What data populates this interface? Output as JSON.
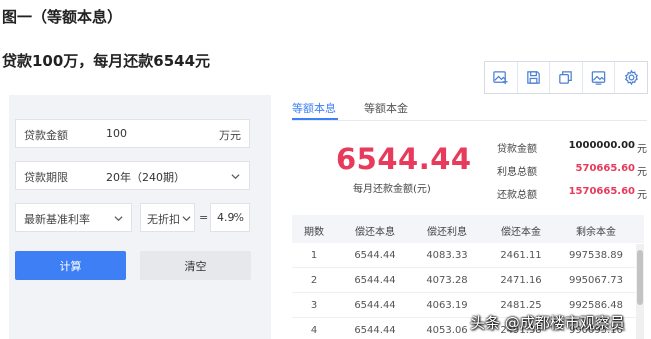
{
  "figure_title": "图一（等额本息）",
  "headline": "贷款100万，每月还款6544元",
  "toolbar": {
    "buttons": [
      {
        "icon": "image-add-icon"
      },
      {
        "icon": "save-icon"
      },
      {
        "icon": "copy-icon"
      },
      {
        "icon": "image-icon"
      },
      {
        "icon": "gear-icon"
      }
    ]
  },
  "form": {
    "amount_label": "贷款金额",
    "amount_value": "100",
    "amount_unit": "万元",
    "term_label": "贷款期限",
    "term_value": "20年（240期）",
    "rate_type": "最新基准利率",
    "discount": "无折扣",
    "equals": "=",
    "rate_value": "4.9",
    "rate_unit": "%",
    "calc_button": "计算",
    "clear_button": "清空"
  },
  "tabs": {
    "active": "等额本息",
    "inactive": "等额本金"
  },
  "result": {
    "monthly_amount": "6544.44",
    "monthly_label": "每月还款金额(元)",
    "summary": [
      {
        "label": "贷款金额",
        "value": "1000000.00",
        "unit": "元",
        "color": "#222222"
      },
      {
        "label": "利息总额",
        "value": "570665.60",
        "unit": "元",
        "color": "#e83a5a"
      },
      {
        "label": "还款总额",
        "value": "1570665.60",
        "unit": "元",
        "color": "#e83a5a"
      }
    ]
  },
  "table": {
    "headers": [
      "期数",
      "偿还本息",
      "偿还利息",
      "偿还本金",
      "剩余本金"
    ],
    "rows": [
      [
        "1",
        "6544.44",
        "4083.33",
        "2461.11",
        "997538.89"
      ],
      [
        "2",
        "6544.44",
        "4073.28",
        "2471.16",
        "995067.73"
      ],
      [
        "3",
        "6544.44",
        "4063.19",
        "2481.25",
        "992586.48"
      ],
      [
        "4",
        "6544.44",
        "4053.06",
        "2491.38",
        "990095.10"
      ]
    ]
  },
  "watermark": "头条 @成都楼市观察员",
  "colors": {
    "accent": "#3e7ff5",
    "highlight": "#e83a5a"
  }
}
